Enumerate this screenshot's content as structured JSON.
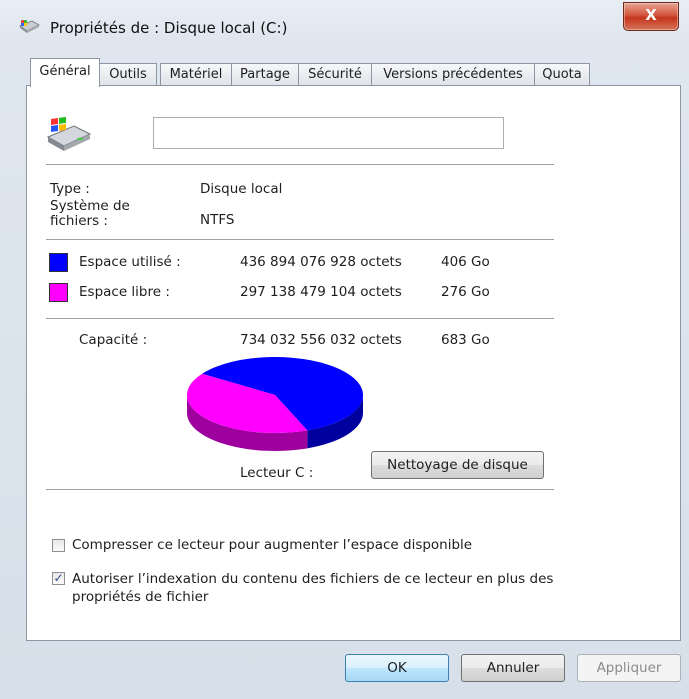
{
  "window": {
    "title": "Propriétés de : Disque local (C:)",
    "close_label": "X"
  },
  "tabs": [
    {
      "label": "Général",
      "active": true
    },
    {
      "label": "Outils"
    },
    {
      "label": "Matériel"
    },
    {
      "label": "Partage"
    },
    {
      "label": "Sécurité"
    },
    {
      "label": "Versions précédentes"
    },
    {
      "label": "Quota"
    }
  ],
  "general": {
    "drive_name_value": "",
    "type_label": "Type :",
    "type_value": "Disque local",
    "fs_label": "Système de fichiers :",
    "fs_value": "NTFS",
    "used": {
      "label": "Espace utilisé :",
      "bytes": "436 894 076 928 octets",
      "size": "406 Go",
      "color": "#0000ff"
    },
    "free": {
      "label": "Espace libre :",
      "bytes": "297 138 479 104 octets",
      "size": "276 Go",
      "color": "#ff00ff"
    },
    "capacity": {
      "label": "Capacité :",
      "bytes": "734 032 556 032 octets",
      "size": "683 Go"
    },
    "drive_label": "Lecteur C :",
    "cleanup_button": "Nettoyage de disque",
    "compress_label": "Compresser ce lecteur pour augmenter l’espace disponible",
    "compress_checked": false,
    "index_label": "Autoriser l’indexation du contenu des fichiers de ce lecteur en plus des propriétés de fichier",
    "index_checked": true,
    "check_glyph": "✓"
  },
  "chart_data": {
    "type": "pie",
    "title": "",
    "labels": [
      "Espace utilisé",
      "Espace libre"
    ],
    "values": [
      406,
      276
    ],
    "unit": "Go",
    "colors": [
      "#0000ff",
      "#ff00ff"
    ]
  },
  "footer": {
    "ok": "OK",
    "cancel": "Annuler",
    "apply": "Appliquer"
  }
}
